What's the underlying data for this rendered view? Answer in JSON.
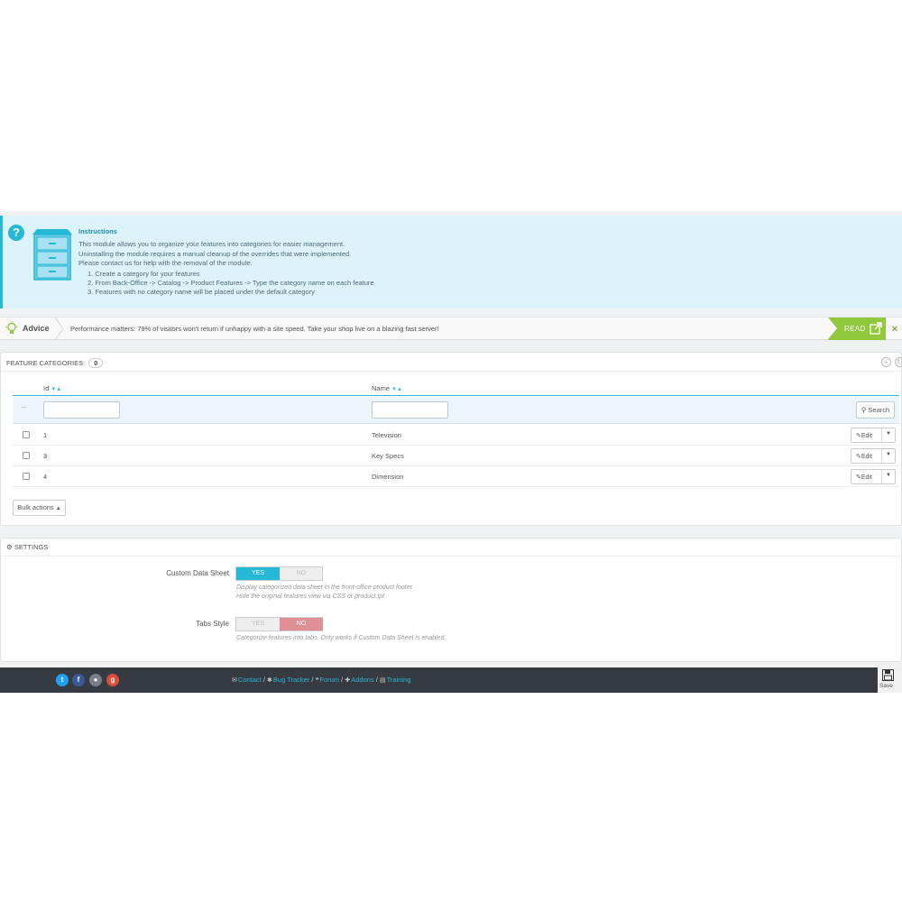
{
  "instructions": {
    "title": "Instructions",
    "lines": [
      "This module allows you to organize your features into categories for easier management.",
      "Uninstalling the module requires a manual cleanup of the overrides that were implemented.",
      "Please contact us for help with the removal of the module."
    ],
    "steps": [
      "1. Create a category for your features",
      "2. From Back-Office -> Catalog -> Product Features -> Type the category name on each feature",
      "3. Features with no category name will be placed under the default category"
    ]
  },
  "advice": {
    "label": "Advice",
    "text": "Performance matters: 79% of visitors won't return if unhappy with a site speed. Take your shop live on a blazing fast server!",
    "read_label": "READ",
    "close": "×"
  },
  "feature_categories": {
    "title": "FEATURE CATEGORIES",
    "count": "0",
    "columns": {
      "id": "Id",
      "name": "Name"
    },
    "filter_dash": "--",
    "search_label": "Search",
    "rows": [
      {
        "id": "1",
        "name": "Television",
        "action": "Edit"
      },
      {
        "id": "3",
        "name": "Key Specs",
        "action": "Edit"
      },
      {
        "id": "4",
        "name": "Dimension",
        "action": "Edit"
      }
    ],
    "bulk_label": "Bulk actions"
  },
  "settings": {
    "title": "SETTINGS",
    "custom_data_sheet": {
      "label": "Custom Data Sheet",
      "yes": "YES",
      "no": "NO",
      "selected": "YES",
      "help_1": "Display categorized data sheet in the front-office product footer.",
      "help_2": "Hide the original features view via CSS or product.tpl"
    },
    "tabs_style": {
      "label": "Tabs Style",
      "yes": "YES",
      "no": "NO",
      "selected": "NO",
      "help": "Categorize features into tabs. Only works if Custom Data Sheet is enabled."
    }
  },
  "footer": {
    "links": [
      "Contact",
      "Bug Tracker",
      "Forum",
      "Addons",
      "Training"
    ],
    "separator": "/",
    "save_label": "Save"
  },
  "colors": {
    "accent": "#25b9d7",
    "advice_green": "#92c83e",
    "no_active": "#e08f95",
    "footer_bg": "#363a41"
  }
}
